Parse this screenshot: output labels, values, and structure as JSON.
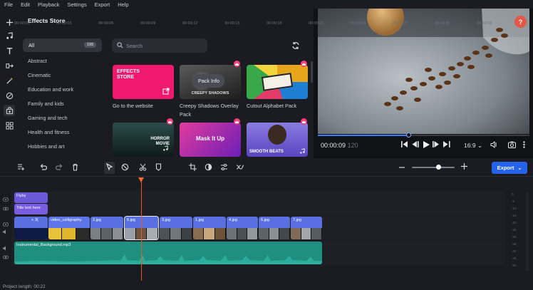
{
  "menu": [
    "File",
    "Edit",
    "Playback",
    "Settings",
    "Export",
    "Help"
  ],
  "store": {
    "title": "Effects Store",
    "all_label": "All",
    "all_count": "199",
    "categories": [
      "Abstract",
      "Cinematic",
      "Education and work",
      "Family and kids",
      "Gaming and tech",
      "Health and fitness",
      "Hobbies and art"
    ],
    "search_placeholder": "Search",
    "cards": [
      {
        "name": "effects-store",
        "caption": "Go to the website",
        "art": "EFFECTS STORE",
        "bg": "#f0186f"
      },
      {
        "name": "creepy-shadows",
        "caption": "Creepy Shadows Overlay Pack",
        "art": "CREEPY SHADOWS",
        "bg": "#3a3a3a"
      },
      {
        "name": "cutout-alphabet",
        "caption": "Cutout Alphabet Pack",
        "art": "",
        "bg": "#e7a51c"
      },
      {
        "name": "horror-movie",
        "caption": "",
        "art": "HORROR MOVIE",
        "bg": "#1d3334"
      },
      {
        "name": "mask-it-up",
        "caption": "",
        "art": "Mask It Up",
        "bg": "#c81e8a"
      },
      {
        "name": "smooth-beats",
        "caption": "",
        "art": "SMOOTH BEATS",
        "bg": "#6b58c8"
      }
    ],
    "tooltip": "Pack Info"
  },
  "preview": {
    "timecode": "00:00:09",
    "timecode_frames": "120",
    "aspect_ratio": "16:9",
    "progress_fraction": 0.43,
    "help_label": "?"
  },
  "timeline": {
    "export_label": "Export",
    "zoom_fraction": 0.62,
    "ruler": [
      "00:00:00",
      "00:00:03",
      "00:00:06",
      "00:00:09",
      "00:00:12",
      "00:00:15",
      "00:00:18",
      "00:00:21",
      "00:00:24",
      "00:00:27",
      "00:00:30",
      "00:00:33"
    ],
    "text_clips": [
      {
        "label": "Flyby",
        "color": "#6a5ad8"
      },
      {
        "label": "Title text here",
        "color": "#7a5ce0"
      }
    ],
    "video_clips": [
      {
        "label": "+ 3(",
        "color": "#5a6fe0"
      },
      {
        "label": "video_calligraphy.",
        "color": "#5c75e8"
      },
      {
        "label": "2.jpg",
        "color": "#5a70e2"
      },
      {
        "label": "5.jpg",
        "color": "#5a70e2"
      },
      {
        "label": "3.jpg",
        "color": "#5a70e2"
      },
      {
        "label": "1.jpg",
        "color": "#5a70e2"
      },
      {
        "label": "4.jpg",
        "color": "#5a70e2"
      },
      {
        "label": "6.jpg",
        "color": "#5a70e2"
      },
      {
        "label": "7.jpg",
        "color": "#5a70e2"
      }
    ],
    "audio_clip": {
      "label": "Instrumental_Background.mp3",
      "color": "#1f8f80"
    },
    "meter_labels": [
      "0",
      "-5",
      "-10",
      "-15",
      "-20",
      "-25",
      "-30",
      "-35",
      "-40",
      "-45",
      "-50"
    ]
  },
  "status": "Project length: 00:22"
}
